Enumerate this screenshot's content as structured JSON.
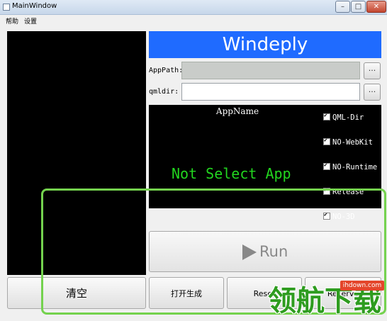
{
  "window": {
    "title": "MainWindow",
    "controls": {
      "minimize": "–",
      "maximize": "□",
      "close": "✕"
    }
  },
  "menu": {
    "items": [
      "帮助",
      "设置"
    ]
  },
  "banner": {
    "title": "Windeply",
    "color": "#1f6bff"
  },
  "fields": {
    "apppath_label": "AppPath:",
    "apppath_value": "",
    "qmldir_label": "qmldir:",
    "qmldir_value": "",
    "browse_label": "..."
  },
  "app_info": {
    "name_label": "AppName",
    "status": "Not Select App",
    "status_color": "#22d51f",
    "options": [
      {
        "label": "QML-Dir",
        "checked": true
      },
      {
        "label": "NO-WebKit",
        "checked": true
      },
      {
        "label": "NO-Runtime",
        "checked": true
      },
      {
        "label": "Release",
        "checked": true
      },
      {
        "label": "NO-3D",
        "checked": true
      }
    ]
  },
  "actions": {
    "run_label": "Run",
    "clear_label": "清空",
    "generate_label": "打开生成",
    "reset_label": "Reset",
    "reserve_label": "Reserve"
  },
  "watermark": {
    "site": "ihdown.com",
    "text": "领航下载",
    "frame_color": "#74d24e"
  }
}
